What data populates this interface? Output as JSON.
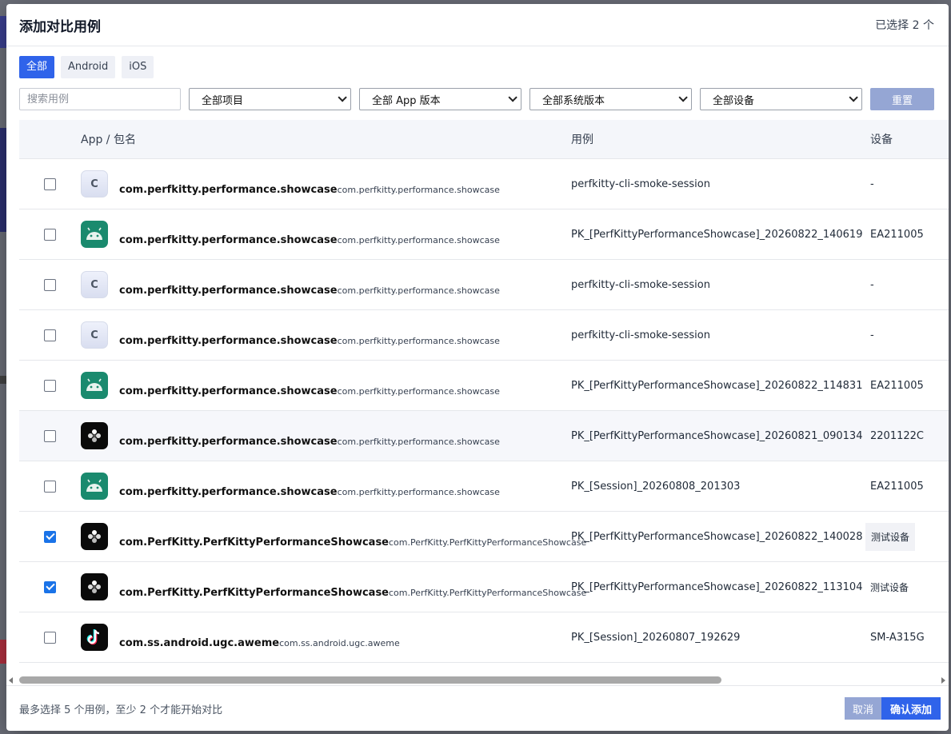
{
  "modal": {
    "title": "添加对比用例",
    "selected_count": "已选择 2 个"
  },
  "tabs": [
    {
      "label": "全部",
      "active": true
    },
    {
      "label": "Android",
      "active": false
    },
    {
      "label": "iOS",
      "active": false
    }
  ],
  "filters": {
    "search_placeholder": "搜索用例",
    "project": "全部项目",
    "app_version": "全部 App 版本",
    "os_version": "全部系统版本",
    "device": "全部设备",
    "reset_label": "重置"
  },
  "table": {
    "headers": {
      "app": "App / 包名",
      "case": "用例",
      "device": "设备"
    },
    "rows": [
      {
        "icon": "c-letter-icon",
        "name": "com.perfkitty.performance.showcase",
        "pkg": "com.perfkitty.performance.showcase",
        "case": "perfkitty-cli-smoke-session",
        "device": "-",
        "checked": false
      },
      {
        "icon": "android-icon",
        "name": "com.perfkitty.performance.showcase",
        "pkg": "com.perfkitty.performance.showcase",
        "case": "PK_[PerfKittyPerformanceShowcase]_20260822_140619",
        "device": "EA211005",
        "checked": false
      },
      {
        "icon": "c-letter-icon",
        "name": "com.perfkitty.performance.showcase",
        "pkg": "com.perfkitty.performance.showcase",
        "case": "perfkitty-cli-smoke-session",
        "device": "-",
        "checked": false
      },
      {
        "icon": "c-letter-icon",
        "name": "com.perfkitty.performance.showcase",
        "pkg": "com.perfkitty.performance.showcase",
        "case": "perfkitty-cli-smoke-session",
        "device": "-",
        "checked": false
      },
      {
        "icon": "android-icon",
        "name": "com.perfkitty.performance.showcase",
        "pkg": "com.perfkitty.performance.showcase",
        "case": "PK_[PerfKittyPerformanceShowcase]_20260822_114831",
        "device": "EA211005",
        "checked": false
      },
      {
        "icon": "perfkitty-icon",
        "name": "com.perfkitty.performance.showcase",
        "pkg": "com.perfkitty.performance.showcase",
        "case": "PK_[PerfKittyPerformanceShowcase]_20260821_090134",
        "device": "2201122C",
        "checked": false
      },
      {
        "icon": "android-icon",
        "name": "com.perfkitty.performance.showcase",
        "pkg": "com.perfkitty.performance.showcase",
        "case": "PK_[Session]_20260808_201303",
        "device": "EA211005",
        "checked": false
      },
      {
        "icon": "perfkitty-icon",
        "name": "com.PerfKitty.PerfKittyPerformanceShowcase",
        "pkg": "com.PerfKitty.PerfKittyPerformanceShowcase",
        "case": "PK_[PerfKittyPerformanceShowcase]_20260822_140028",
        "device": "测试设备",
        "checked": true
      },
      {
        "icon": "perfkitty-icon",
        "name": "com.PerfKitty.PerfKittyPerformanceShowcase",
        "pkg": "com.PerfKitty.PerfKittyPerformanceShowcase",
        "case": "PK_[PerfKittyPerformanceShowcase]_20260822_113104",
        "device": "测试设备",
        "checked": true
      },
      {
        "icon": "tiktok-icon",
        "name": "com.ss.android.ugc.aweme",
        "pkg": "com.ss.android.ugc.aweme",
        "case": "PK_[Session]_20260807_192629",
        "device": "SM-A315G",
        "checked": false
      }
    ]
  },
  "footer": {
    "hint": "最多选择 5 个用例，至少 2 个才能开始对比",
    "cancel_label": "取消",
    "confirm_label": "确认添加"
  },
  "colors": {
    "accent": "#2f63ea",
    "muted_button": "#95a6d4",
    "android_icon_bg": "#1a8a6e"
  }
}
